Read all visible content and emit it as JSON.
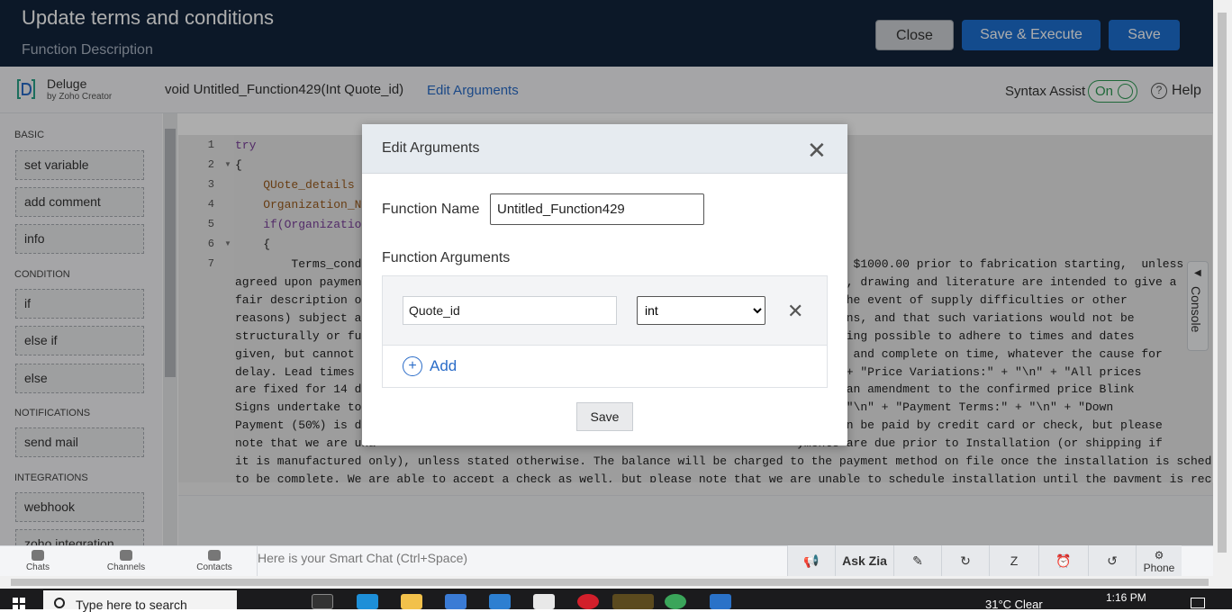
{
  "header": {
    "title": "Update terms and conditions",
    "subtitle": "Function Description",
    "buttons": {
      "close": "Close",
      "save_execute": "Save & Execute",
      "save": "Save"
    }
  },
  "toolbar": {
    "product_name": "Deluge",
    "product_by": "by Zoho Creator",
    "signature": "void  Untitled_Function429(Int Quote_id)",
    "edit_arguments": "Edit Arguments",
    "syntax_assist_label": "Syntax Assist",
    "syntax_assist_state": "On",
    "help": "Help"
  },
  "sidebar": {
    "sections": [
      {
        "title": "BASIC",
        "items": [
          "set variable",
          "add comment",
          "info"
        ]
      },
      {
        "title": "CONDITION",
        "items": [
          "if",
          "else if",
          "else"
        ]
      },
      {
        "title": "NOTIFICATIONS",
        "items": [
          "send mail"
        ]
      },
      {
        "title": "INTEGRATIONS",
        "items": [
          "webhook",
          "zoho integration"
        ]
      }
    ]
  },
  "editor": {
    "line_numbers": [
      "1",
      "2",
      "3",
      "4",
      "5",
      "6",
      "7"
    ],
    "lines": [
      "try",
      "{",
      "    QUote_details =",
      "    Organization_Nam",
      "    if(Organization_",
      "    {",
      "        Terms_condit                                                                    $1000.00 prior to fabrication starting,  unless",
      "agreed upon payment                                                               tions, drawing and literature are intended to give a",
      "fair description of                                                               (in the event of supply difficulties or other",
      "reasons) subject alt                                                             riations, and that such variations would not be",
      "structurally or func                                                            everything possible to adhere to times and dates",
      "given, but cannot un                                                            deliver and complete on time, whatever the cause for",
      "delay. Lead times ar                                                            + \"\\n\" + \"Price Variations:\" + \"\\n\" + \"All prices",
      "are fixed for 14 day                                                            ng for an amendment to the confirmed price Blink",
      "Signs undertake to a                                                            ct.\" + \"\\n\" + \"Payment Terms:\" + \"\\n\" + \"Down",
      "Payment (50%) is due                                                            ment can be paid by credit card or check, but please",
      "note that we are una                                                            yments are due prior to Installation (or shipping if",
      "it is manufactured only), unless stated otherwise. The balance will be charged to the payment method on file once the installation is scheduled",
      "to be complete. We are able to accept a check as well, but please note that we are unable to schedule installation until the payment is received"
    ],
    "console": "Console"
  },
  "modal": {
    "title": "Edit Arguments",
    "function_name_label": "Function Name",
    "function_name_value": "Untitled_Function429",
    "function_arguments_label": "Function Arguments",
    "argument": {
      "name": "Quote_id",
      "type": "int"
    },
    "type_options": [
      "int"
    ],
    "add": "Add",
    "save": "Save"
  },
  "chatbar": {
    "items": [
      "Chats",
      "Channels",
      "Contacts"
    ],
    "smart_chat_placeholder": "Here is your Smart Chat (Ctrl+Space)",
    "ask_zia": "Ask Zia",
    "phone": "Phone"
  },
  "taskbar": {
    "search_placeholder": "Type here to search",
    "weather": "31°C  Clear",
    "time": "1:16 PM"
  }
}
